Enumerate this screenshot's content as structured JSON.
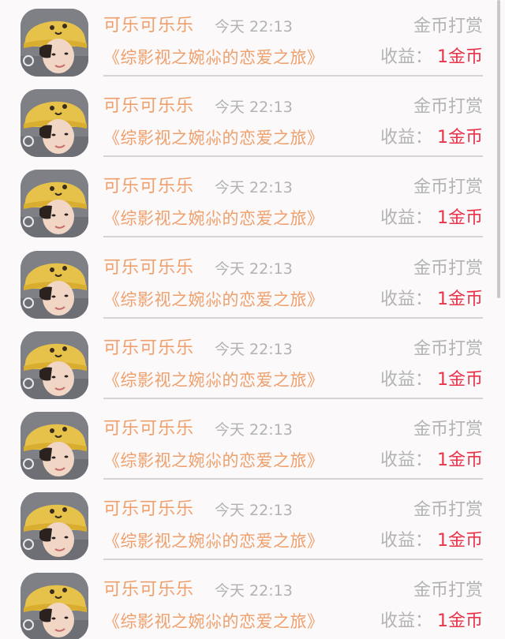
{
  "records": [
    {
      "user": "可乐可乐乐",
      "time": "今天 22:13",
      "type": "金币打赏",
      "book": "《综影视之婉尛的恋爱之旅》",
      "income_label": "收益：",
      "income_value": "1金币"
    },
    {
      "user": "可乐可乐乐",
      "time": "今天 22:13",
      "type": "金币打赏",
      "book": "《综影视之婉尛的恋爱之旅》",
      "income_label": "收益：",
      "income_value": "1金币"
    },
    {
      "user": "可乐可乐乐",
      "time": "今天 22:13",
      "type": "金币打赏",
      "book": "《综影视之婉尛的恋爱之旅》",
      "income_label": "收益：",
      "income_value": "1金币"
    },
    {
      "user": "可乐可乐乐",
      "time": "今天 22:13",
      "type": "金币打赏",
      "book": "《综影视之婉尛的恋爱之旅》",
      "income_label": "收益：",
      "income_value": "1金币"
    },
    {
      "user": "可乐可乐乐",
      "time": "今天 22:13",
      "type": "金币打赏",
      "book": "《综影视之婉尛的恋爱之旅》",
      "income_label": "收益：",
      "income_value": "1金币"
    },
    {
      "user": "可乐可乐乐",
      "time": "今天 22:13",
      "type": "金币打赏",
      "book": "《综影视之婉尛的恋爱之旅》",
      "income_label": "收益：",
      "income_value": "1金币"
    },
    {
      "user": "可乐可乐乐",
      "time": "今天 22:13",
      "type": "金币打赏",
      "book": "《综影视之婉尛的恋爱之旅》",
      "income_label": "收益：",
      "income_value": "1金币"
    },
    {
      "user": "可乐可乐乐",
      "time": "今天 22:13",
      "type": "金币打赏",
      "book": "《综影视之婉尛的恋爱之旅》",
      "income_label": "收益：",
      "income_value": "1金币"
    }
  ],
  "colors": {
    "name": "#ef9f6b",
    "muted": "#b3b3b3",
    "accent": "#e8334a",
    "background": "#fbf9fa"
  },
  "icons": {
    "avatar": "user-avatar-photo"
  }
}
